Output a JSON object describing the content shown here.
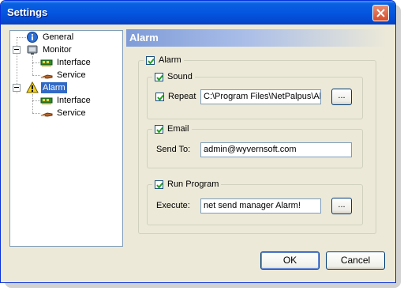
{
  "window": {
    "title": "Settings"
  },
  "tree": {
    "items": [
      {
        "label": "General",
        "icon": "info-icon"
      },
      {
        "label": "Monitor",
        "icon": "monitor-icon"
      },
      {
        "label": "Interface",
        "icon": "network-card-icon"
      },
      {
        "label": "Service",
        "icon": "service-icon"
      },
      {
        "label": "Alarm",
        "icon": "warning-icon",
        "selected": true
      },
      {
        "label": "Interface",
        "icon": "network-card-icon"
      },
      {
        "label": "Service",
        "icon": "service-icon"
      }
    ]
  },
  "panel": {
    "header": "Alarm",
    "alarm": {
      "label": "Alarm",
      "checked": true
    },
    "sound": {
      "label": "Sound",
      "checked": true,
      "repeat_label": "Repeat",
      "repeat_checked": true,
      "path": "C:\\Program Files\\NetPalpus\\Al",
      "browse_label": "..."
    },
    "email": {
      "label": "Email",
      "checked": true,
      "send_to_label": "Send To:",
      "send_to_value": "admin@wyvernsoft.com"
    },
    "run_program": {
      "label": "Run Program",
      "checked": true,
      "execute_label": "Execute:",
      "execute_value": "net send manager Alarm!",
      "browse_label": "..."
    }
  },
  "buttons": {
    "ok": "OK",
    "cancel": "Cancel"
  }
}
